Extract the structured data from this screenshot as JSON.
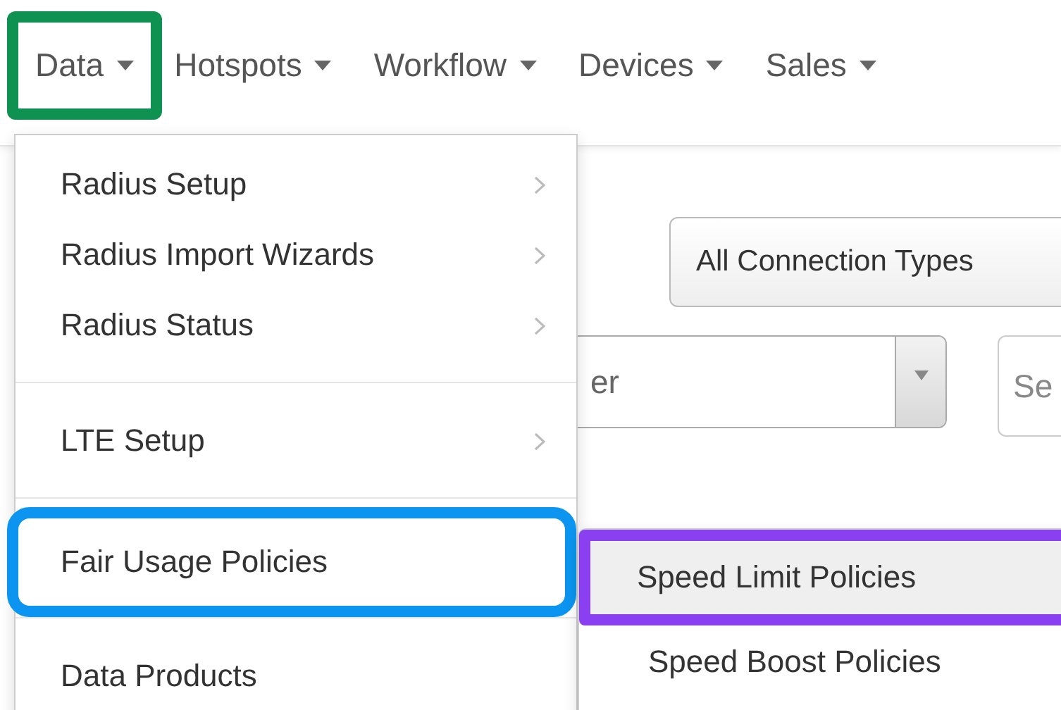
{
  "nav": [
    {
      "label": "Data",
      "highlighted": true,
      "color": "#0f9152"
    },
    {
      "label": "Hotspots",
      "highlighted": false
    },
    {
      "label": "Workflow",
      "highlighted": false
    },
    {
      "label": "Devices",
      "highlighted": false
    },
    {
      "label": "Sales",
      "highlighted": false
    }
  ],
  "background": {
    "connection_select": {
      "value": "All Connection Types"
    },
    "select_2": {
      "value": "er"
    },
    "field_3": {
      "placeholder": "Se"
    }
  },
  "menu": {
    "items": [
      {
        "kind": "item",
        "label": "Radius Setup",
        "submenu": true,
        "highlighted": false
      },
      {
        "kind": "item",
        "label": "Radius Import Wizards",
        "submenu": true,
        "highlighted": false
      },
      {
        "kind": "item",
        "label": "Radius Status",
        "submenu": true,
        "highlighted": false
      },
      {
        "kind": "divider"
      },
      {
        "kind": "item",
        "label": "LTE Setup",
        "submenu": true,
        "highlighted": false
      },
      {
        "kind": "divider"
      },
      {
        "kind": "item",
        "label": "Fair Usage Policies",
        "submenu": false,
        "highlighted": true,
        "color": "#0b95f0"
      },
      {
        "kind": "divider"
      },
      {
        "kind": "item",
        "label": "Data Products",
        "submenu": false,
        "highlighted": false
      }
    ]
  },
  "submenu": {
    "items": [
      {
        "label": "Speed Limit Policies",
        "selected": true,
        "color": "#8a3ff0"
      },
      {
        "label": "Speed Boost Policies",
        "selected": false
      }
    ]
  }
}
